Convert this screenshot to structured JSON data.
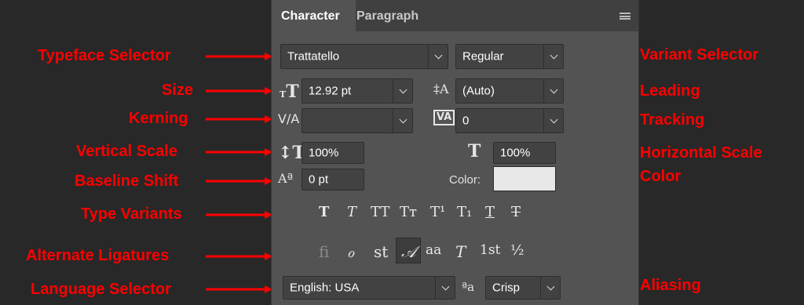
{
  "tabs": {
    "character": "Character",
    "paragraph": "Paragraph"
  },
  "font": {
    "typeface": "Trattatello",
    "variant": "Regular"
  },
  "size": "12.92 pt",
  "leading": "(Auto)",
  "kerning": "",
  "tracking": "0",
  "vertical_scale": "100%",
  "horizontal_scale": "100%",
  "baseline_shift": "0 pt",
  "color": {
    "label": "Color:",
    "value": "#e8e8e8"
  },
  "type_variants": [
    "T",
    "T",
    "TT",
    "Tт",
    "T¹",
    "T₁",
    "T",
    "T"
  ],
  "ligatures": [
    "ﬁ",
    "ℴ",
    "st",
    "𝒜",
    "aa",
    "𝑇",
    "1st",
    "½"
  ],
  "language": "English: USA",
  "aliasing": "Crisp",
  "aliasing_icon": "ªa",
  "annotations": {
    "typeface": "Typeface Selector",
    "size": "Size",
    "kerning": "Kerning",
    "vertical_scale": "Vertical Scale",
    "baseline_shift": "Baseline Shift",
    "type_variants": "Type Variants",
    "ligatures": "Alternate Ligatures",
    "language": "Language Selector",
    "variant": "Variant Selector",
    "leading": "Leading",
    "tracking": "Tracking",
    "horizontal_scale": "Horizontal Scale",
    "color": "Color",
    "aliasing": "Aliasing"
  },
  "annotation_color": "#ff0000"
}
